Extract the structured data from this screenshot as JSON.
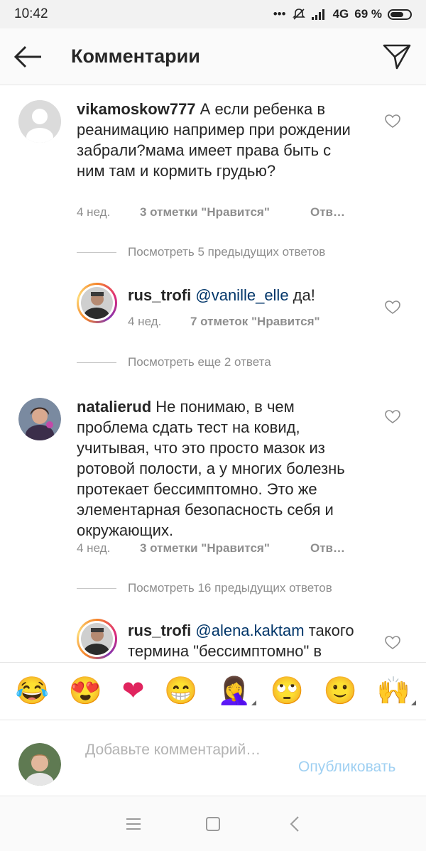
{
  "status_bar": {
    "time": "10:42",
    "network": "4G",
    "battery": "69 %",
    "battery_level": 0.69
  },
  "header": {
    "title": "Комментарии"
  },
  "comments": [
    {
      "username": "vikamoskow777",
      "text": " А если ребенка в реанимацию например при рождении забрали?мама имеет права быть с ним там и кормить грудью?",
      "time": "4 нед.",
      "likes": "3 отметки \"Нравится\"",
      "reply": "Отв…"
    },
    {
      "username": "rus_trofi",
      "mention": "@vanille_elle",
      "text": " да!",
      "time": "4 нед.",
      "likes": "7 отметок \"Нравится\""
    },
    {
      "username": "natalierud",
      "text": " Не понимаю, в чем проблема сдать тест на ковид, учитывая, что это просто мазок из ротовой полости, а у многих болезнь протекает бессимптомно. Это же элементарная безопасность себя и окружающих.",
      "time": "4 нед.",
      "likes": "3 отметки \"Нравится\"",
      "reply": "Отв…"
    },
    {
      "username": "rus_trofi",
      "mention": "@alena.kaktam",
      "text": " такого термина \"бессимптомно\" в"
    }
  ],
  "view_replies": [
    "Посмотреть 5 предыдущих ответов",
    "Посмотреть еще 2 ответа",
    "Посмотреть 16 предыдущих ответов"
  ],
  "emoji_bar": [
    "😂",
    "😍",
    "❤",
    "😁",
    "🤦‍♀️",
    "🙄",
    "🙂",
    "🙌"
  ],
  "composer": {
    "placeholder": "Добавьте комментарий…",
    "publish_label": "Опубликовать"
  },
  "colors": {
    "link": "#003569",
    "muted": "#8e8e8e",
    "publish_disabled": "#9fd0f2",
    "heart_emoji": "#e0245e"
  }
}
